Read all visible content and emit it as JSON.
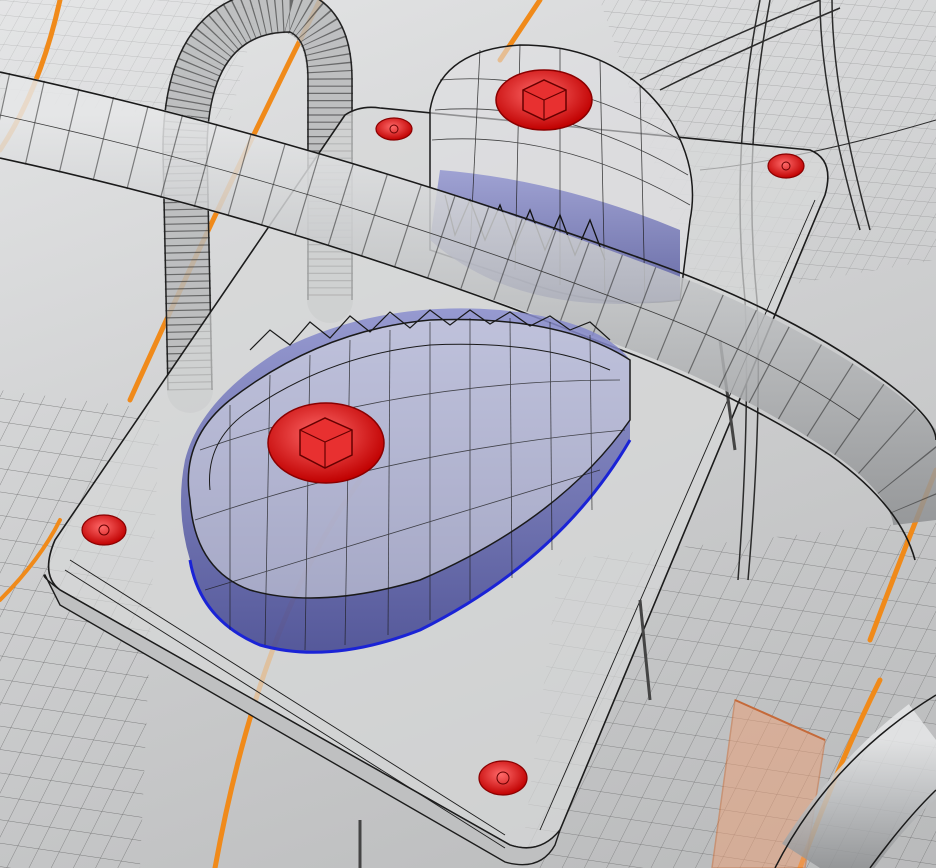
{
  "viewport": {
    "view_mode": "ghosted-wireframe",
    "colors": {
      "background": "#cfd0d1",
      "mesh_line": "#1a1a1a",
      "plate_fill": "#d7d8d9",
      "tube_fill": "#cdced0",
      "housing_fill": "#5a5fa8",
      "housing_edge": "#1a23d6",
      "fastener": "#e01010",
      "frame_accent": "#f08a1a",
      "block_accent": "#e9a17a"
    }
  },
  "scene": {
    "objects": [
      {
        "name": "mounting-plate",
        "material": "ghosted"
      },
      {
        "name": "main-tube",
        "material": "ghosted"
      },
      {
        "name": "bent-hose",
        "material": "ghosted"
      },
      {
        "name": "housing-front",
        "material": "selected-blue"
      },
      {
        "name": "housing-back",
        "material": "selected-blue"
      },
      {
        "name": "fastener-bolts",
        "material": "highlight-red",
        "count": 6
      },
      {
        "name": "frame-rails",
        "material": "orange-wire"
      },
      {
        "name": "block-part",
        "material": "orange-wire"
      }
    ]
  }
}
